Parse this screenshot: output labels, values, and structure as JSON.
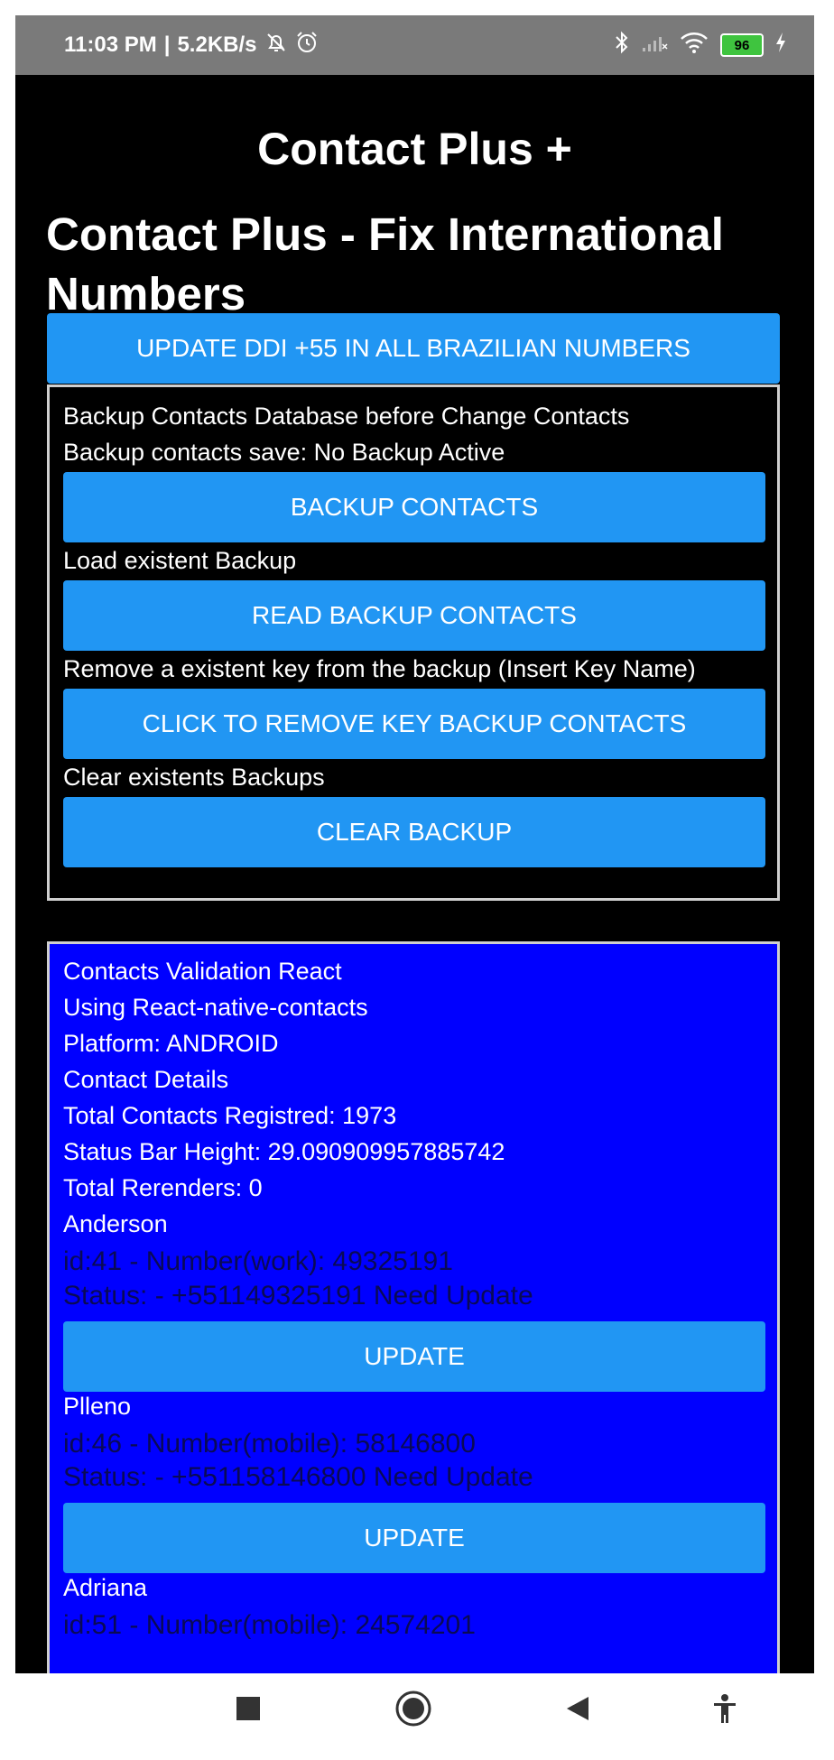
{
  "status_bar": {
    "time": "11:03 PM",
    "network_speed": "5.2KB/s",
    "battery_level": "96",
    "icons": [
      "muted-bell-icon",
      "alarm-icon",
      "bluetooth-icon",
      "signal-icon",
      "wifi-icon",
      "battery-icon",
      "charging-icon"
    ]
  },
  "app": {
    "title": "Contact Plus +",
    "screen_title": "Contact Plus - Fix International Numbers",
    "update_ddi_label": "UPDATE DDI +55 IN ALL BRAZILIAN NUMBERS"
  },
  "backup": {
    "intro": "Backup Contacts Database before Change Contacts",
    "save_status": "Backup contacts save: No Backup Active",
    "backup_button": "BACKUP CONTACTS",
    "load_label": "Load existent Backup",
    "read_button": "READ BACKUP CONTACTS",
    "remove_label": "Remove a existent key from the backup (Insert Key Name)",
    "remove_button": "CLICK TO REMOVE KEY BACKUP CONTACTS",
    "clear_label": "Clear existents Backups",
    "clear_button": "CLEAR BACKUP"
  },
  "info": {
    "title": "Contacts Validation React",
    "library": "Using React-native-contacts",
    "platform": "Platform: ANDROID",
    "details": "Contact Details",
    "total_contacts": "Total Contacts Registred: 1973",
    "status_bar_height": "Status Bar Height: 29.090909957885742",
    "rerenders": "Total Rerenders: 0"
  },
  "contacts": [
    {
      "name": "Anderson",
      "number_line": "id:41 - Number(work): 49325191",
      "status_line": "Status: - +551149325191 Need Update",
      "button": "UPDATE"
    },
    {
      "name": "Plleno",
      "number_line": "id:46 - Number(mobile): 58146800",
      "status_line": "Status: - +551158146800 Need Update",
      "button": "UPDATE"
    },
    {
      "name": "Adriana",
      "number_line": "id:51 - Number(mobile): 24574201"
    }
  ],
  "colors": {
    "button_blue": "#2196f3",
    "panel_blue": "#0000ff",
    "background": "#000000",
    "status_bar_gray": "#7a7a7a"
  },
  "nav": {
    "icons": [
      "recents-square-icon",
      "home-circle-icon",
      "back-triangle-icon",
      "accessibility-icon"
    ]
  }
}
